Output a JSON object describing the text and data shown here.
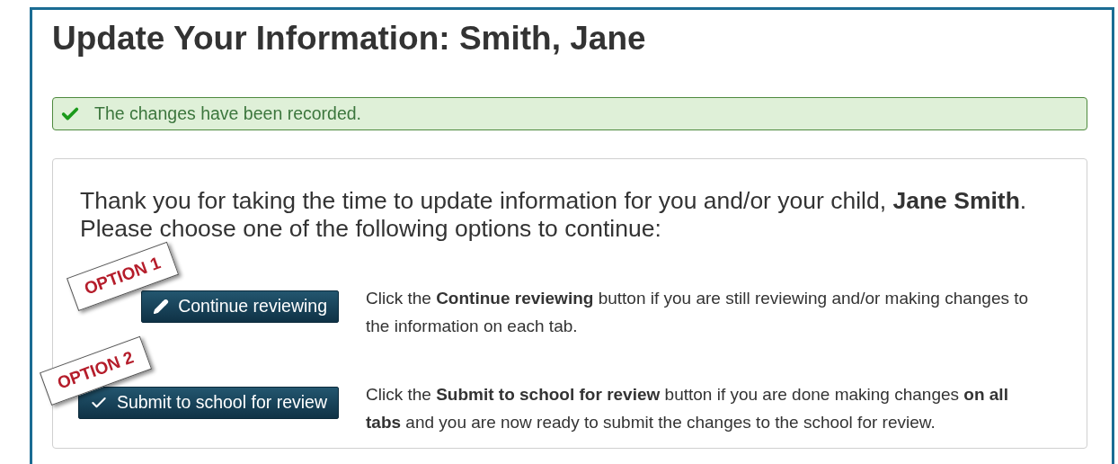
{
  "page": {
    "title": "Update Your Information: Smith, Jane"
  },
  "alert": {
    "kind": "success",
    "text": "The changes have been recorded."
  },
  "intro": [
    "Thank you for taking the time to update information for you and/or your child, **Jane Smith**.",
    "Please choose one of the following options to continue:"
  ],
  "options": [
    {
      "stamp": "OPTION 1",
      "kind": "edit",
      "button": "Continue reviewing",
      "description": "Click the **Continue reviewing** button if you are still reviewing and/or making changes to the information on each tab."
    },
    {
      "stamp": "OPTION 2",
      "kind": "submit",
      "button": "Submit to school for review",
      "description": "Click the **Submit to school for review** button if you are done making changes **on all tabs** and you are now ready to submit the changes to the school for review."
    }
  ]
}
